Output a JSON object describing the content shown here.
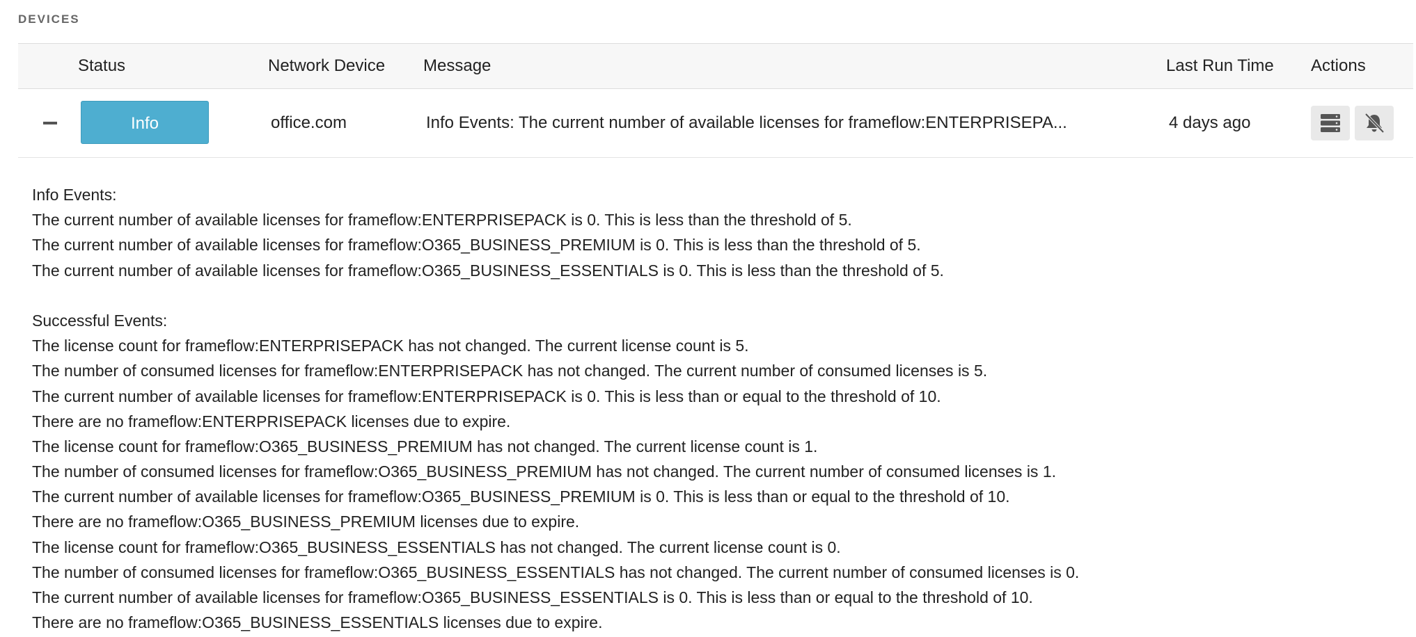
{
  "section": {
    "title": "DEVICES"
  },
  "table": {
    "headers": {
      "status": "Status",
      "network_device": "Network Device",
      "message": "Message",
      "last_run_time": "Last Run Time",
      "actions": "Actions"
    },
    "row": {
      "status_label": "Info",
      "network_device": "office.com",
      "message": "Info Events: The current number of available licenses for frameflow:ENTERPRISEPA...",
      "last_run_time": "4 days ago",
      "toggle_icon": "minus-icon",
      "action_icons": [
        "server-icon",
        "bell-slash-icon"
      ]
    }
  },
  "details": {
    "info_heading": "Info Events:",
    "info_lines": [
      "The current number of available licenses for frameflow:ENTERPRISEPACK is 0. This is less than the threshold of 5.",
      "The current number of available licenses for frameflow:O365_BUSINESS_PREMIUM is 0. This is less than the threshold of 5.",
      "The current number of available licenses for frameflow:O365_BUSINESS_ESSENTIALS is 0. This is less than the threshold of 5."
    ],
    "success_heading": "Successful Events:",
    "success_lines": [
      "The license count for frameflow:ENTERPRISEPACK has not changed. The current license count is 5.",
      "The number of consumed licenses for frameflow:ENTERPRISEPACK has not changed. The current number of consumed licenses is 5.",
      "The current number of available licenses for frameflow:ENTERPRISEPACK is 0. This is less than or equal to the threshold of 10.",
      "There are no frameflow:ENTERPRISEPACK licenses due to expire.",
      "The license count for frameflow:O365_BUSINESS_PREMIUM has not changed. The current license count is 1.",
      "The number of consumed licenses for frameflow:O365_BUSINESS_PREMIUM has not changed. The current number of consumed licenses is 1.",
      "The current number of available licenses for frameflow:O365_BUSINESS_PREMIUM is 0. This is less than or equal to the threshold of 10.",
      "There are no frameflow:O365_BUSINESS_PREMIUM licenses due to expire.",
      "The license count for frameflow:O365_BUSINESS_ESSENTIALS has not changed. The current license count is 0.",
      "The number of consumed licenses for frameflow:O365_BUSINESS_ESSENTIALS has not changed. The current number of consumed licenses is 0.",
      "The current number of available licenses for frameflow:O365_BUSINESS_ESSENTIALS is 0. This is less than or equal to the threshold of 10.",
      "There are no frameflow:O365_BUSINESS_ESSENTIALS licenses due to expire."
    ]
  }
}
